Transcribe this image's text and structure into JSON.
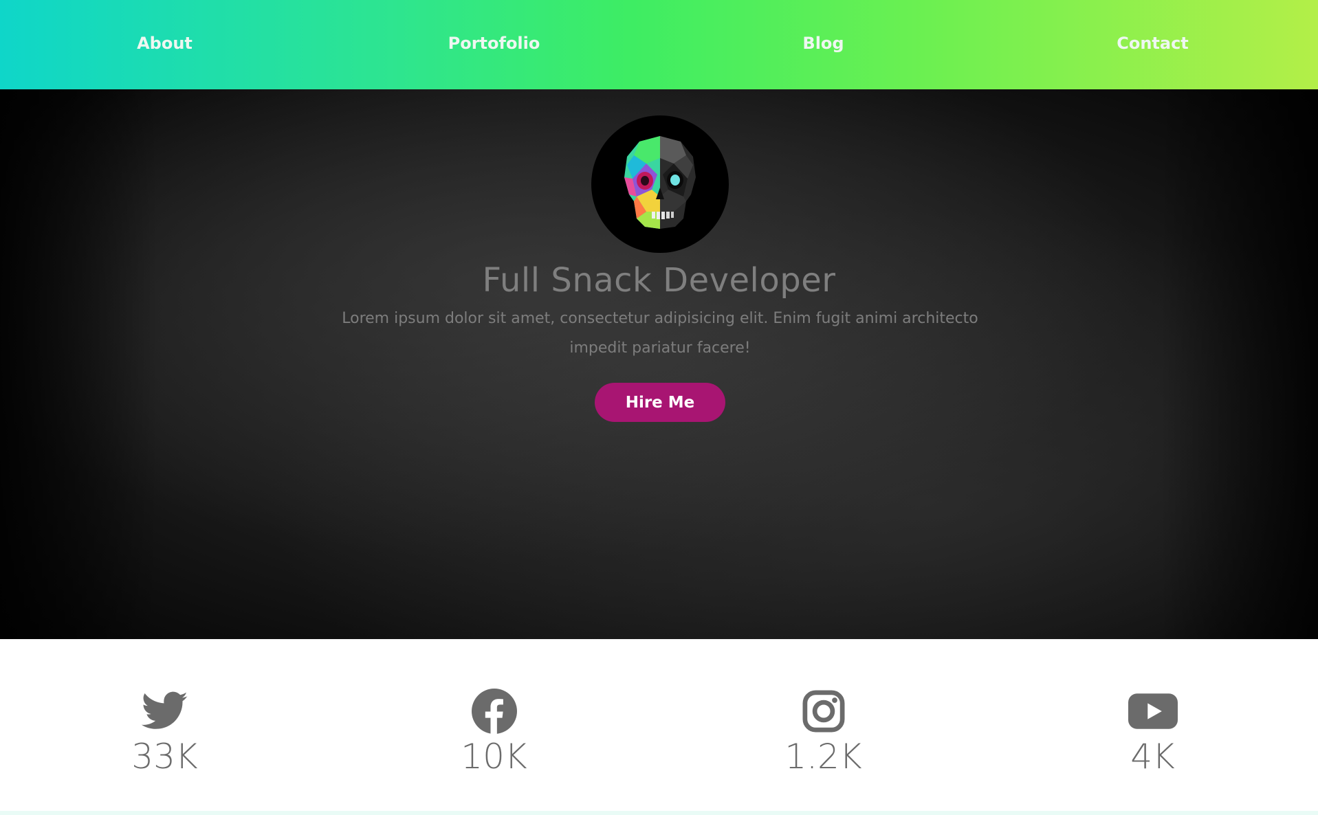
{
  "nav": {
    "items": [
      {
        "label": "About"
      },
      {
        "label": "Portofolio"
      },
      {
        "label": "Blog"
      },
      {
        "label": "Contact"
      }
    ]
  },
  "hero": {
    "title": "Full Snack Developer",
    "description": "Lorem ipsum dolor sit amet, consectetur adipisicing elit. Enim fugit animi architecto impedit pariatur facere!",
    "cta_label": "Hire Me",
    "avatar_icon": "skull-avatar-icon"
  },
  "stats": [
    {
      "icon": "twitter-icon",
      "count": "33K"
    },
    {
      "icon": "facebook-icon",
      "count": "10K"
    },
    {
      "icon": "instagram-icon",
      "count": "1.2K"
    },
    {
      "icon": "youtube-icon",
      "count": "4K"
    }
  ],
  "colors": {
    "accent": "#a81572",
    "nav_gradient_start": "#0fd6c9",
    "nav_gradient_end": "#b3ef48",
    "icon_gray": "#6b6b6b"
  }
}
